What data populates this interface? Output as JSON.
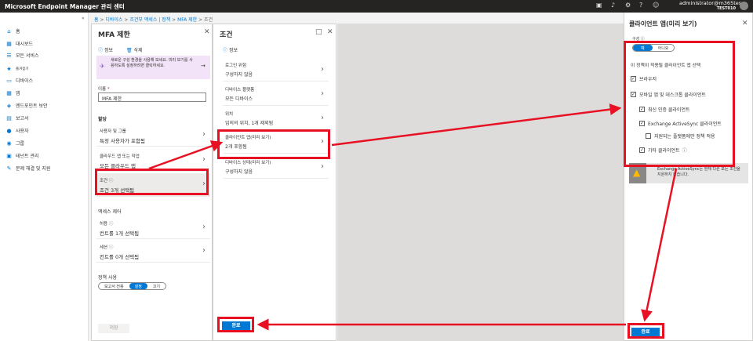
{
  "topbar": {
    "title": "Microsoft Endpoint Manager 관리 센터",
    "user_email": "administrator@m365tes...",
    "tenant": "TEST010"
  },
  "sidebar": {
    "items": [
      {
        "label": "홈",
        "icon": "home-icon",
        "glyph": "⌂"
      },
      {
        "label": "대시보드",
        "icon": "dashboard-icon",
        "glyph": "▦"
      },
      {
        "label": "모든 서비스",
        "icon": "all-services-icon",
        "glyph": "☰"
      },
      {
        "label": "즐겨찾기",
        "icon": "favorites-star-icon",
        "glyph": "★"
      },
      {
        "label": "디바이스",
        "icon": "devices-icon",
        "glyph": "▭"
      },
      {
        "label": "앱",
        "icon": "apps-icon",
        "glyph": "▦"
      },
      {
        "label": "엔드포인트 보안",
        "icon": "security-shield-icon",
        "glyph": "◈"
      },
      {
        "label": "보고서",
        "icon": "reports-icon",
        "glyph": "▤"
      },
      {
        "label": "사용자",
        "icon": "user-icon",
        "glyph": "●"
      },
      {
        "label": "그룹",
        "icon": "groups-icon",
        "glyph": "◉"
      },
      {
        "label": "테넌트 관리",
        "icon": "tenant-admin-icon",
        "glyph": "▣"
      },
      {
        "label": "문제 해결 및 지원",
        "icon": "troubleshoot-wrench-icon",
        "glyph": "✎"
      }
    ]
  },
  "breadcrumb": {
    "home": "홈",
    "items": [
      "디바이스",
      "조건부 액세스 | 정책",
      "MFA 제한",
      "조건"
    ]
  },
  "mfa_blade": {
    "title": "MFA 제한",
    "info": "정보",
    "delete": "삭제",
    "banner": "새로운 구성 환경을 사용해 보세요. 미리 보기를 사용하도록 설정하려면 클릭하세요.",
    "name_label": "이름",
    "name_value": "MFA 제한",
    "assign_header": "할당",
    "users_label": "사용자 및 그룹",
    "users_value": "특정 사용자가 포함됨",
    "apps_label": "클라우드 앱 또는 작업",
    "apps_value": "모든 클라우드 앱",
    "conditions_label": "조건",
    "conditions_value": "조건 3개 선택됨",
    "access_header": "액세스 제어",
    "grant_label": "허용",
    "grant_value": "컨트롤 1개 선택됨",
    "session_label": "세션",
    "session_value": "컨트롤 0개 선택됨",
    "enable_header": "정책 사용",
    "enable_options": [
      "보고서 전용",
      "설정",
      "끄기"
    ],
    "save": "저장"
  },
  "conditions_blade": {
    "title": "조건",
    "info": "정보",
    "rows": [
      {
        "label": "로그인 위험",
        "value": "구성하지 않음"
      },
      {
        "label": "디바이스 플랫폼",
        "value": "모든 디바이스"
      },
      {
        "label": "위치",
        "value": "임의의 위치, 1개 제외됨"
      },
      {
        "label": "클라이언트 앱(미리 보기)",
        "value": "2개 포함됨"
      },
      {
        "label": "디바이스 상태(미리 보기)",
        "value": "구성하지 않음"
      }
    ],
    "done": "완료"
  },
  "client_apps_blade": {
    "title": "클라이언트 앱(미리 보기)",
    "configure_label": "구성",
    "yes": "예",
    "no": "아니요",
    "select_text": "이 정책이 적용될 클라이언트 앱 선택",
    "browser": "브라우저",
    "mobile_desktop": "모바일 앱 및 데스크톱 클라이언트",
    "modern_auth": "최신 인증 클라이언트",
    "eas": "Exchange ActiveSync 클라이언트",
    "supported_only": "지원되는 플랫폼에만 정책 적용",
    "other": "기타 클라이언트",
    "warning": "Exchange ActiveSync는 현재 다른 모든 조건을 지원하지 않습니다.",
    "done": "완료"
  },
  "colors": {
    "accent": "#0078d4",
    "highlight": "#e81123",
    "banner": "#f3e3f8"
  }
}
